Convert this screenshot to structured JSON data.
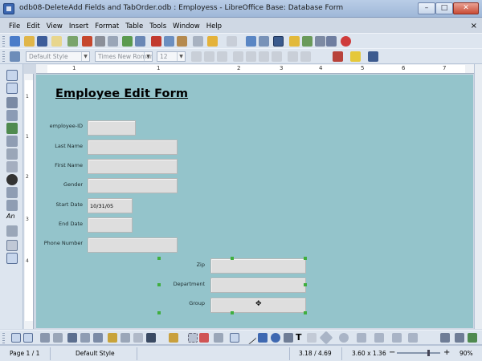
{
  "window": {
    "title": "odb08-DeleteAdd Fields and TabOrder.odb : Employess - LibreOffice Base: Database Form",
    "min_label": "–",
    "max_label": "□",
    "close_label": "✕"
  },
  "menu": {
    "items": [
      "File",
      "Edit",
      "View",
      "Insert",
      "Format",
      "Table",
      "Tools",
      "Window",
      "Help"
    ],
    "doc_close": "×"
  },
  "formatting": {
    "paragraph_style": "Default Style",
    "font_name": "Times New Roman",
    "font_size": "12"
  },
  "ruler": {
    "h_numbers": [
      "1",
      "1",
      "2",
      "3",
      "4",
      "5",
      "6",
      "7"
    ],
    "v_numbers": [
      "1",
      "1",
      "2",
      "3",
      "4"
    ]
  },
  "form": {
    "title": "Employee Edit Form",
    "fields": [
      {
        "label": "employee-ID",
        "value": ""
      },
      {
        "label": "Last Name",
        "value": ""
      },
      {
        "label": "First Name",
        "value": ""
      },
      {
        "label": "Gender",
        "value": ""
      },
      {
        "label": "Start Date",
        "value": "10/31/05"
      },
      {
        "label": "End Date",
        "value": ""
      },
      {
        "label": "Phone Number",
        "value": ""
      }
    ],
    "selected_fields": [
      {
        "label": "Zip",
        "value": ""
      },
      {
        "label": "Department",
        "value": ""
      },
      {
        "label": "Group",
        "value": ""
      }
    ]
  },
  "status": {
    "page": "Page 1 / 1",
    "style": "Default Style",
    "position": "3.18 / 4.69",
    "size": "3.60 x 1.36",
    "zoom": "90%",
    "zoom_minus": "−",
    "zoom_plus": "+"
  },
  "colors": {
    "document_background": "#94c4cb",
    "selection_handle": "#3fae3f"
  }
}
